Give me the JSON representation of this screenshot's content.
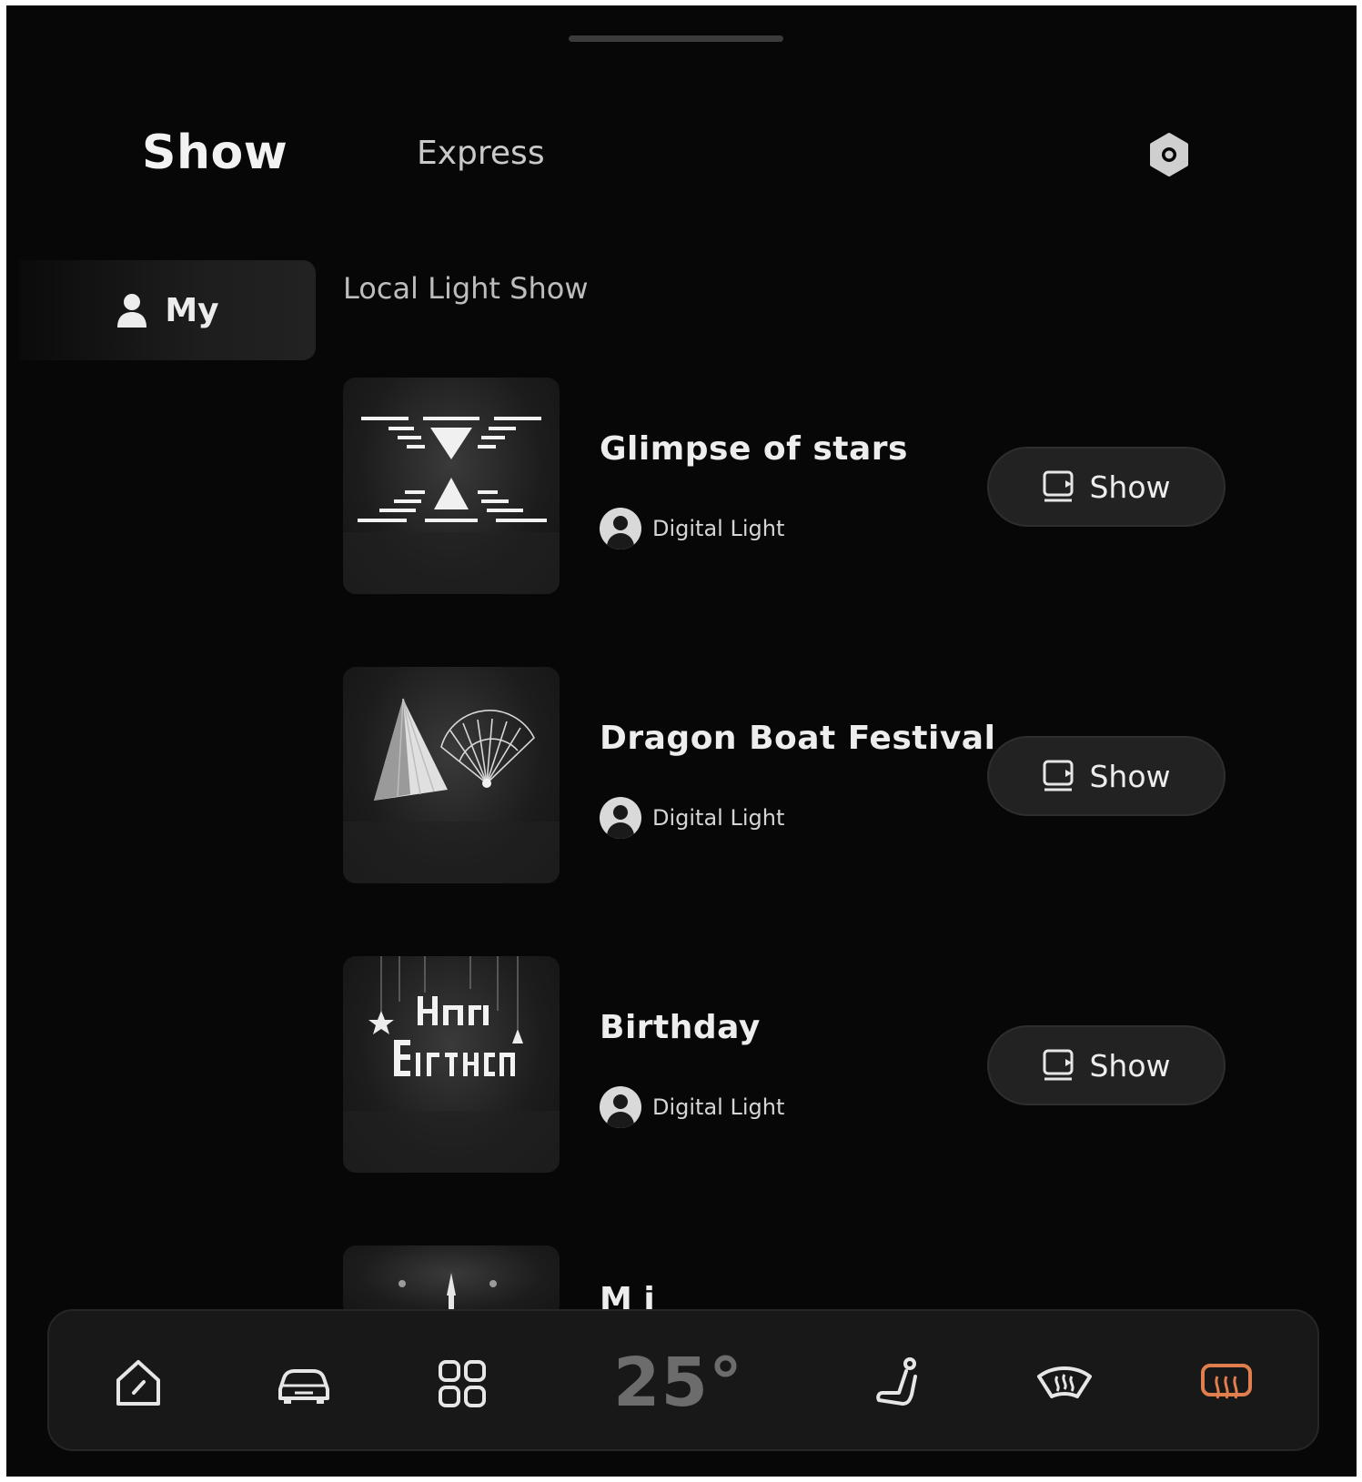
{
  "tabs": {
    "show": "Show",
    "express": "Express"
  },
  "icons": {
    "settings": "gear-icon",
    "user": "user-icon",
    "show_button": "screen-play-icon",
    "home": "home-icon",
    "car": "car-icon",
    "apps": "apps-grid-icon",
    "seat": "seat-icon",
    "front_defrost": "front-defrost-icon",
    "rear_defrost": "rear-defrost-icon"
  },
  "sidebar": {
    "my_label": "My"
  },
  "section": {
    "title": "Local Light Show"
  },
  "items": [
    {
      "title": "Glimpse of stars",
      "author": "Digital Light",
      "button": "Show"
    },
    {
      "title": "Dragon Boat Festival",
      "author": "Digital Light",
      "button": "Show"
    },
    {
      "title": "Birthday",
      "author": "Digital Light",
      "button": "Show"
    }
  ],
  "partial_item": {
    "title_fragment": "M   i"
  },
  "dock": {
    "temperature": "25°"
  },
  "colors": {
    "background": "#070707",
    "dock": "#181818",
    "accent_active": "#e07f4d",
    "temp_text": "#6c6c6c"
  }
}
